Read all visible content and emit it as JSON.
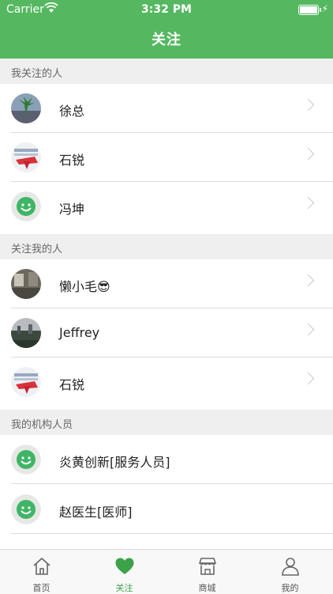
{
  "status_bar": {
    "carrier": "Carrier",
    "time": "3:32 PM"
  },
  "nav": {
    "title": "关注"
  },
  "sections": [
    {
      "header": "我关注的人",
      "items": [
        {
          "name": "徐总",
          "avatar": "plant-photo"
        },
        {
          "name": "石锐",
          "avatar": "red-scarf-photo"
        },
        {
          "name": "冯坤",
          "avatar": "default-smiley"
        }
      ]
    },
    {
      "header": "关注我的人",
      "items": [
        {
          "name": "懒小毛😎",
          "avatar": "room-photo"
        },
        {
          "name": "Jeffrey",
          "avatar": "city-photo"
        },
        {
          "name": "石锐",
          "avatar": "red-scarf-photo"
        }
      ]
    },
    {
      "header": "我的机构人员",
      "items": [
        {
          "name": "炎黄创新[服务人员]",
          "avatar": "default-smiley"
        },
        {
          "name": "赵医生[医师]",
          "avatar": "default-smiley"
        }
      ]
    }
  ],
  "tabbar": {
    "items": [
      {
        "label": "首页",
        "icon": "home-icon"
      },
      {
        "label": "关注",
        "icon": "heart-icon",
        "active": true
      },
      {
        "label": "商城",
        "icon": "store-icon"
      },
      {
        "label": "我的",
        "icon": "person-icon"
      }
    ]
  },
  "colors": {
    "brand_green": "#55b860",
    "active_tab": "#3ba24a"
  }
}
